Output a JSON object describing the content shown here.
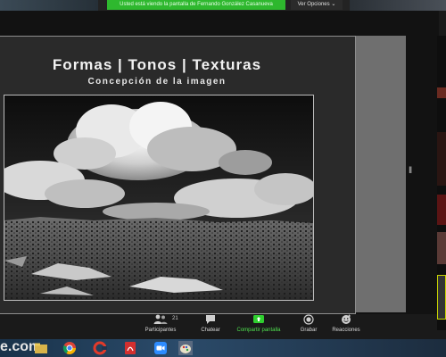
{
  "top_bar": {
    "share_banner": "Usted está viendo la pantalla de Fernando González Casanueva",
    "view_options": "Ver Opciones"
  },
  "slide": {
    "title": "Formas | Tonos | Texturas",
    "subtitle": "Concepción de la imagen"
  },
  "toolbar": {
    "participants_count": "21",
    "items": [
      {
        "label": "Participantes",
        "icon": "participants-icon"
      },
      {
        "label": "Chatear",
        "icon": "chat-icon"
      },
      {
        "label": "Compartir pantalla",
        "icon": "share-screen-icon"
      },
      {
        "label": "Grabar",
        "icon": "record-icon"
      },
      {
        "label": "Reacciones",
        "icon": "reactions-icon"
      }
    ]
  },
  "taskbar": {
    "site_text": "e.com",
    "icons": [
      "folder-icon",
      "chrome-icon",
      "ccleaner-icon",
      "pdf-icon",
      "zoom-icon",
      "paint-icon"
    ]
  },
  "colors": {
    "share_banner": "#2eb82e",
    "share_label": "#4fe04f",
    "stage": "#121212",
    "slide": "#2a2a2a"
  }
}
